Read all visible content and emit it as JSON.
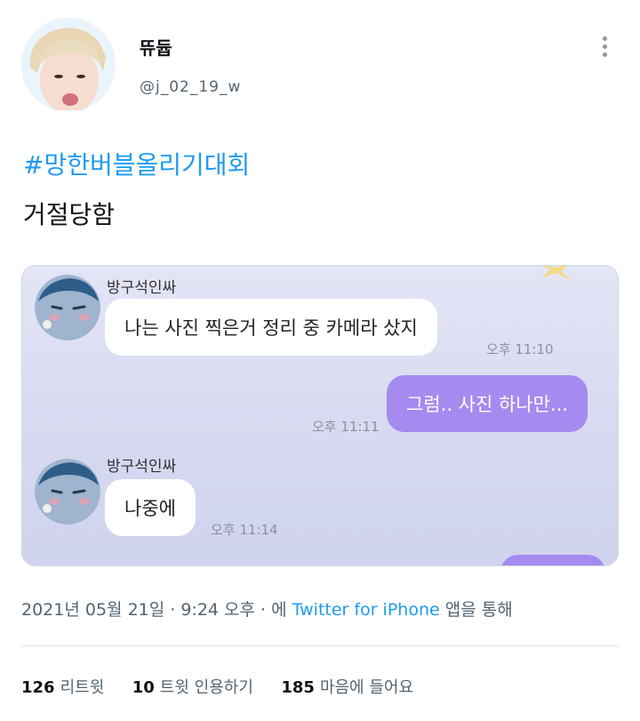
{
  "profile": {
    "display_name": "뜌듑",
    "handle": "@j_02_19_w"
  },
  "tweet": {
    "hashtag": "#망한버블올리기대회",
    "text": "거절당함"
  },
  "chat": {
    "messages": [
      {
        "sender": "방구석인싸",
        "text": "나는 사진 찍은거 정리 중 카메라 샀지",
        "time": "오후 11:10"
      },
      {
        "text": "그럼.. 사진 하나만...",
        "time": "오후 11:11"
      },
      {
        "sender": "방구석인싸",
        "text": "나중에",
        "time": "오후 11:14"
      }
    ]
  },
  "meta": {
    "datetime": "2021년 05월 21일 · 9:24 오후 · 에",
    "source": "Twitter for iPhone",
    "suffix": "앱을 통해"
  },
  "stats": {
    "retweets": "126",
    "retweets_label": "리트윗",
    "quotes": "10",
    "quotes_label": "트윗 인용하기",
    "likes": "185",
    "likes_label": "마음에 들어요"
  },
  "colors": {
    "link": "#1d9bf0",
    "bubble_out": "#a58af0",
    "chat_bg": "#dcdef3"
  },
  "icons": {
    "more": "more-vertical-icon"
  }
}
